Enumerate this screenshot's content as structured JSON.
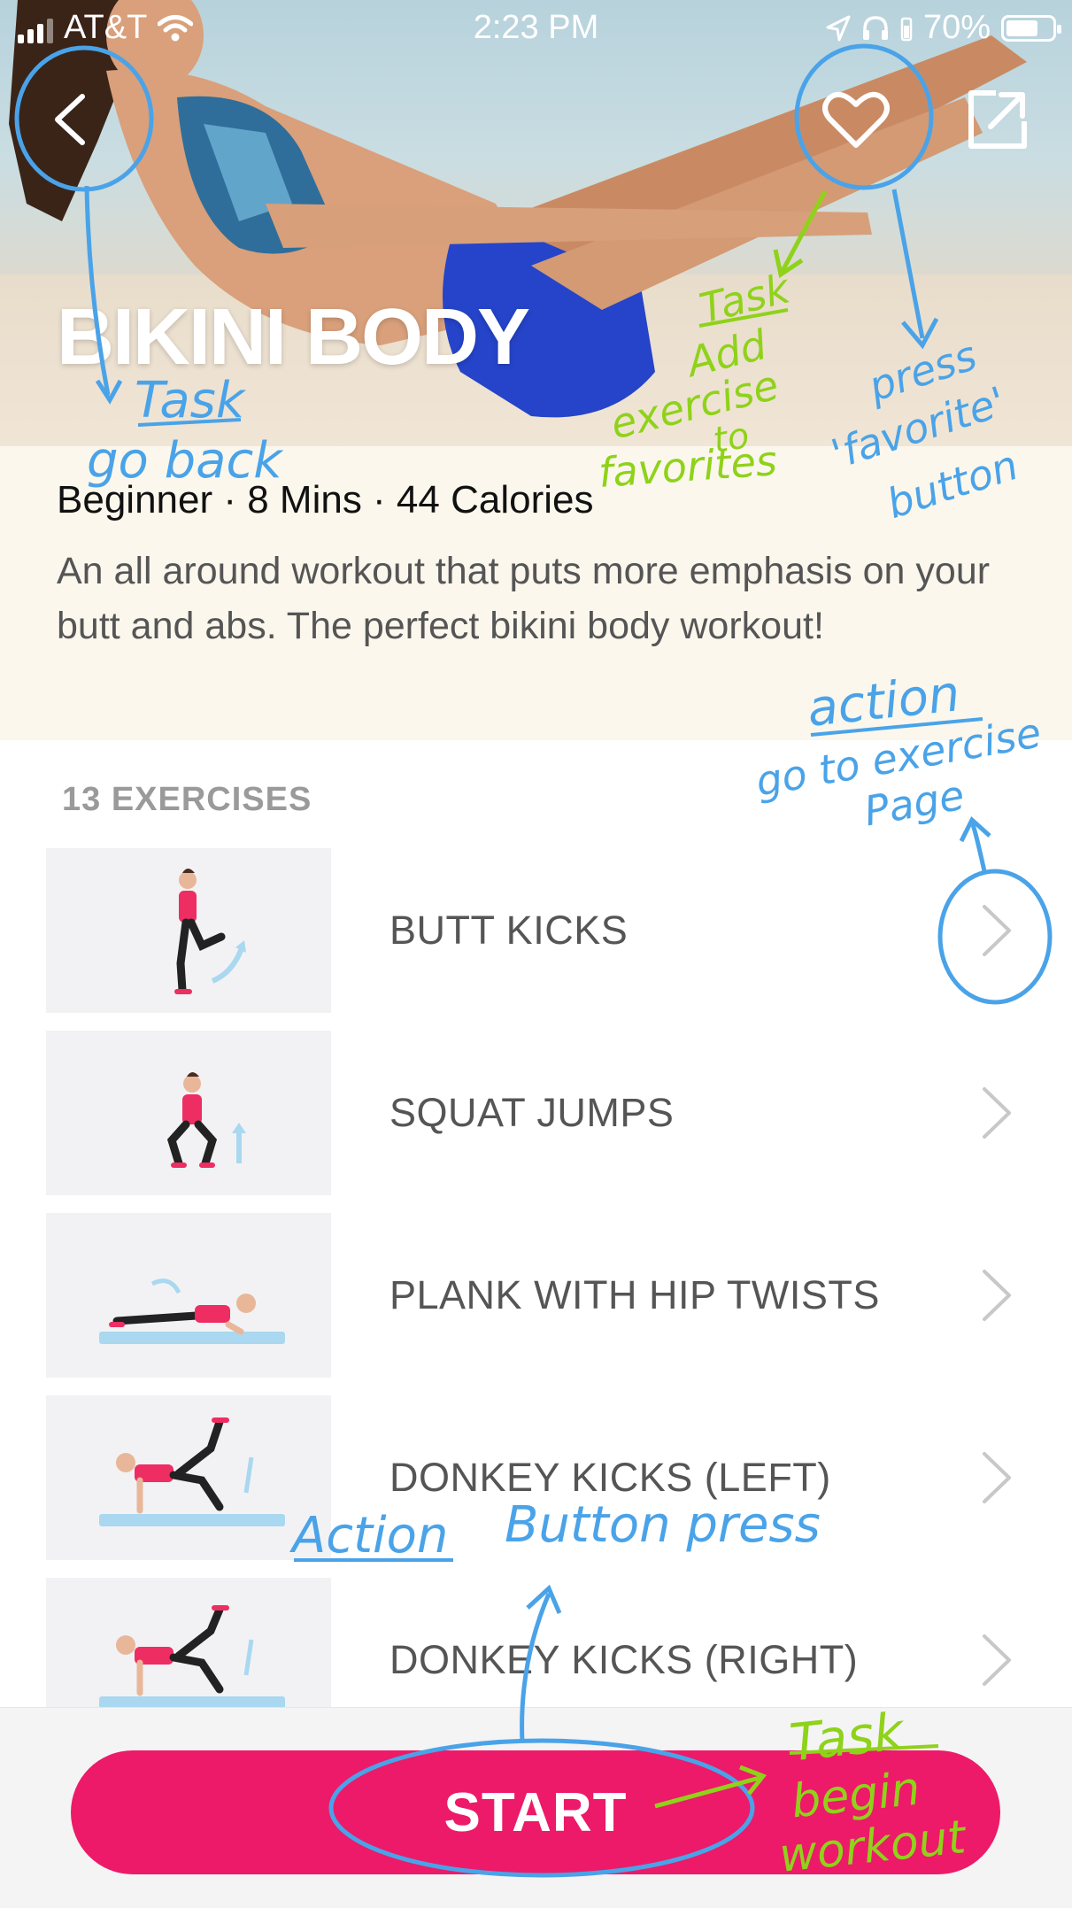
{
  "status_bar": {
    "carrier": "AT&T",
    "time": "2:23 PM",
    "battery": "70%",
    "battery_level": 0.7
  },
  "header": {
    "title": "BIKINI BODY"
  },
  "workout": {
    "meta": "Beginner · 8 Mins · 44 Calories",
    "description": "An all around workout that puts more emphasis on your butt and abs. The perfect bikini body workout!"
  },
  "exercises": {
    "count_label": "13 EXERCISES",
    "items": [
      {
        "label": "BUTT KICKS"
      },
      {
        "label": "SQUAT JUMPS"
      },
      {
        "label": "PLANK WITH HIP TWISTS"
      },
      {
        "label": "DONKEY KICKS (LEFT)"
      },
      {
        "label": "DONKEY KICKS (RIGHT)"
      }
    ]
  },
  "footer": {
    "start_label": "START"
  },
  "colors": {
    "accent": "#ec1a69",
    "info_bg": "#fbf7ed",
    "annotation_blue": "#4aa3e8",
    "annotation_green": "#8fd21a"
  },
  "annotations": {
    "back": [
      "Task",
      "go back"
    ],
    "favorite_task": [
      "Task",
      "Add",
      "exercise",
      "to",
      "favorites"
    ],
    "favorite_action": [
      "press",
      "'favorite'",
      "button"
    ],
    "exercise_action": [
      "action",
      "go to exercise",
      "Page"
    ],
    "start_action": [
      "Action",
      "Button press"
    ],
    "start_task": [
      "Task",
      "begin",
      "workout"
    ]
  }
}
